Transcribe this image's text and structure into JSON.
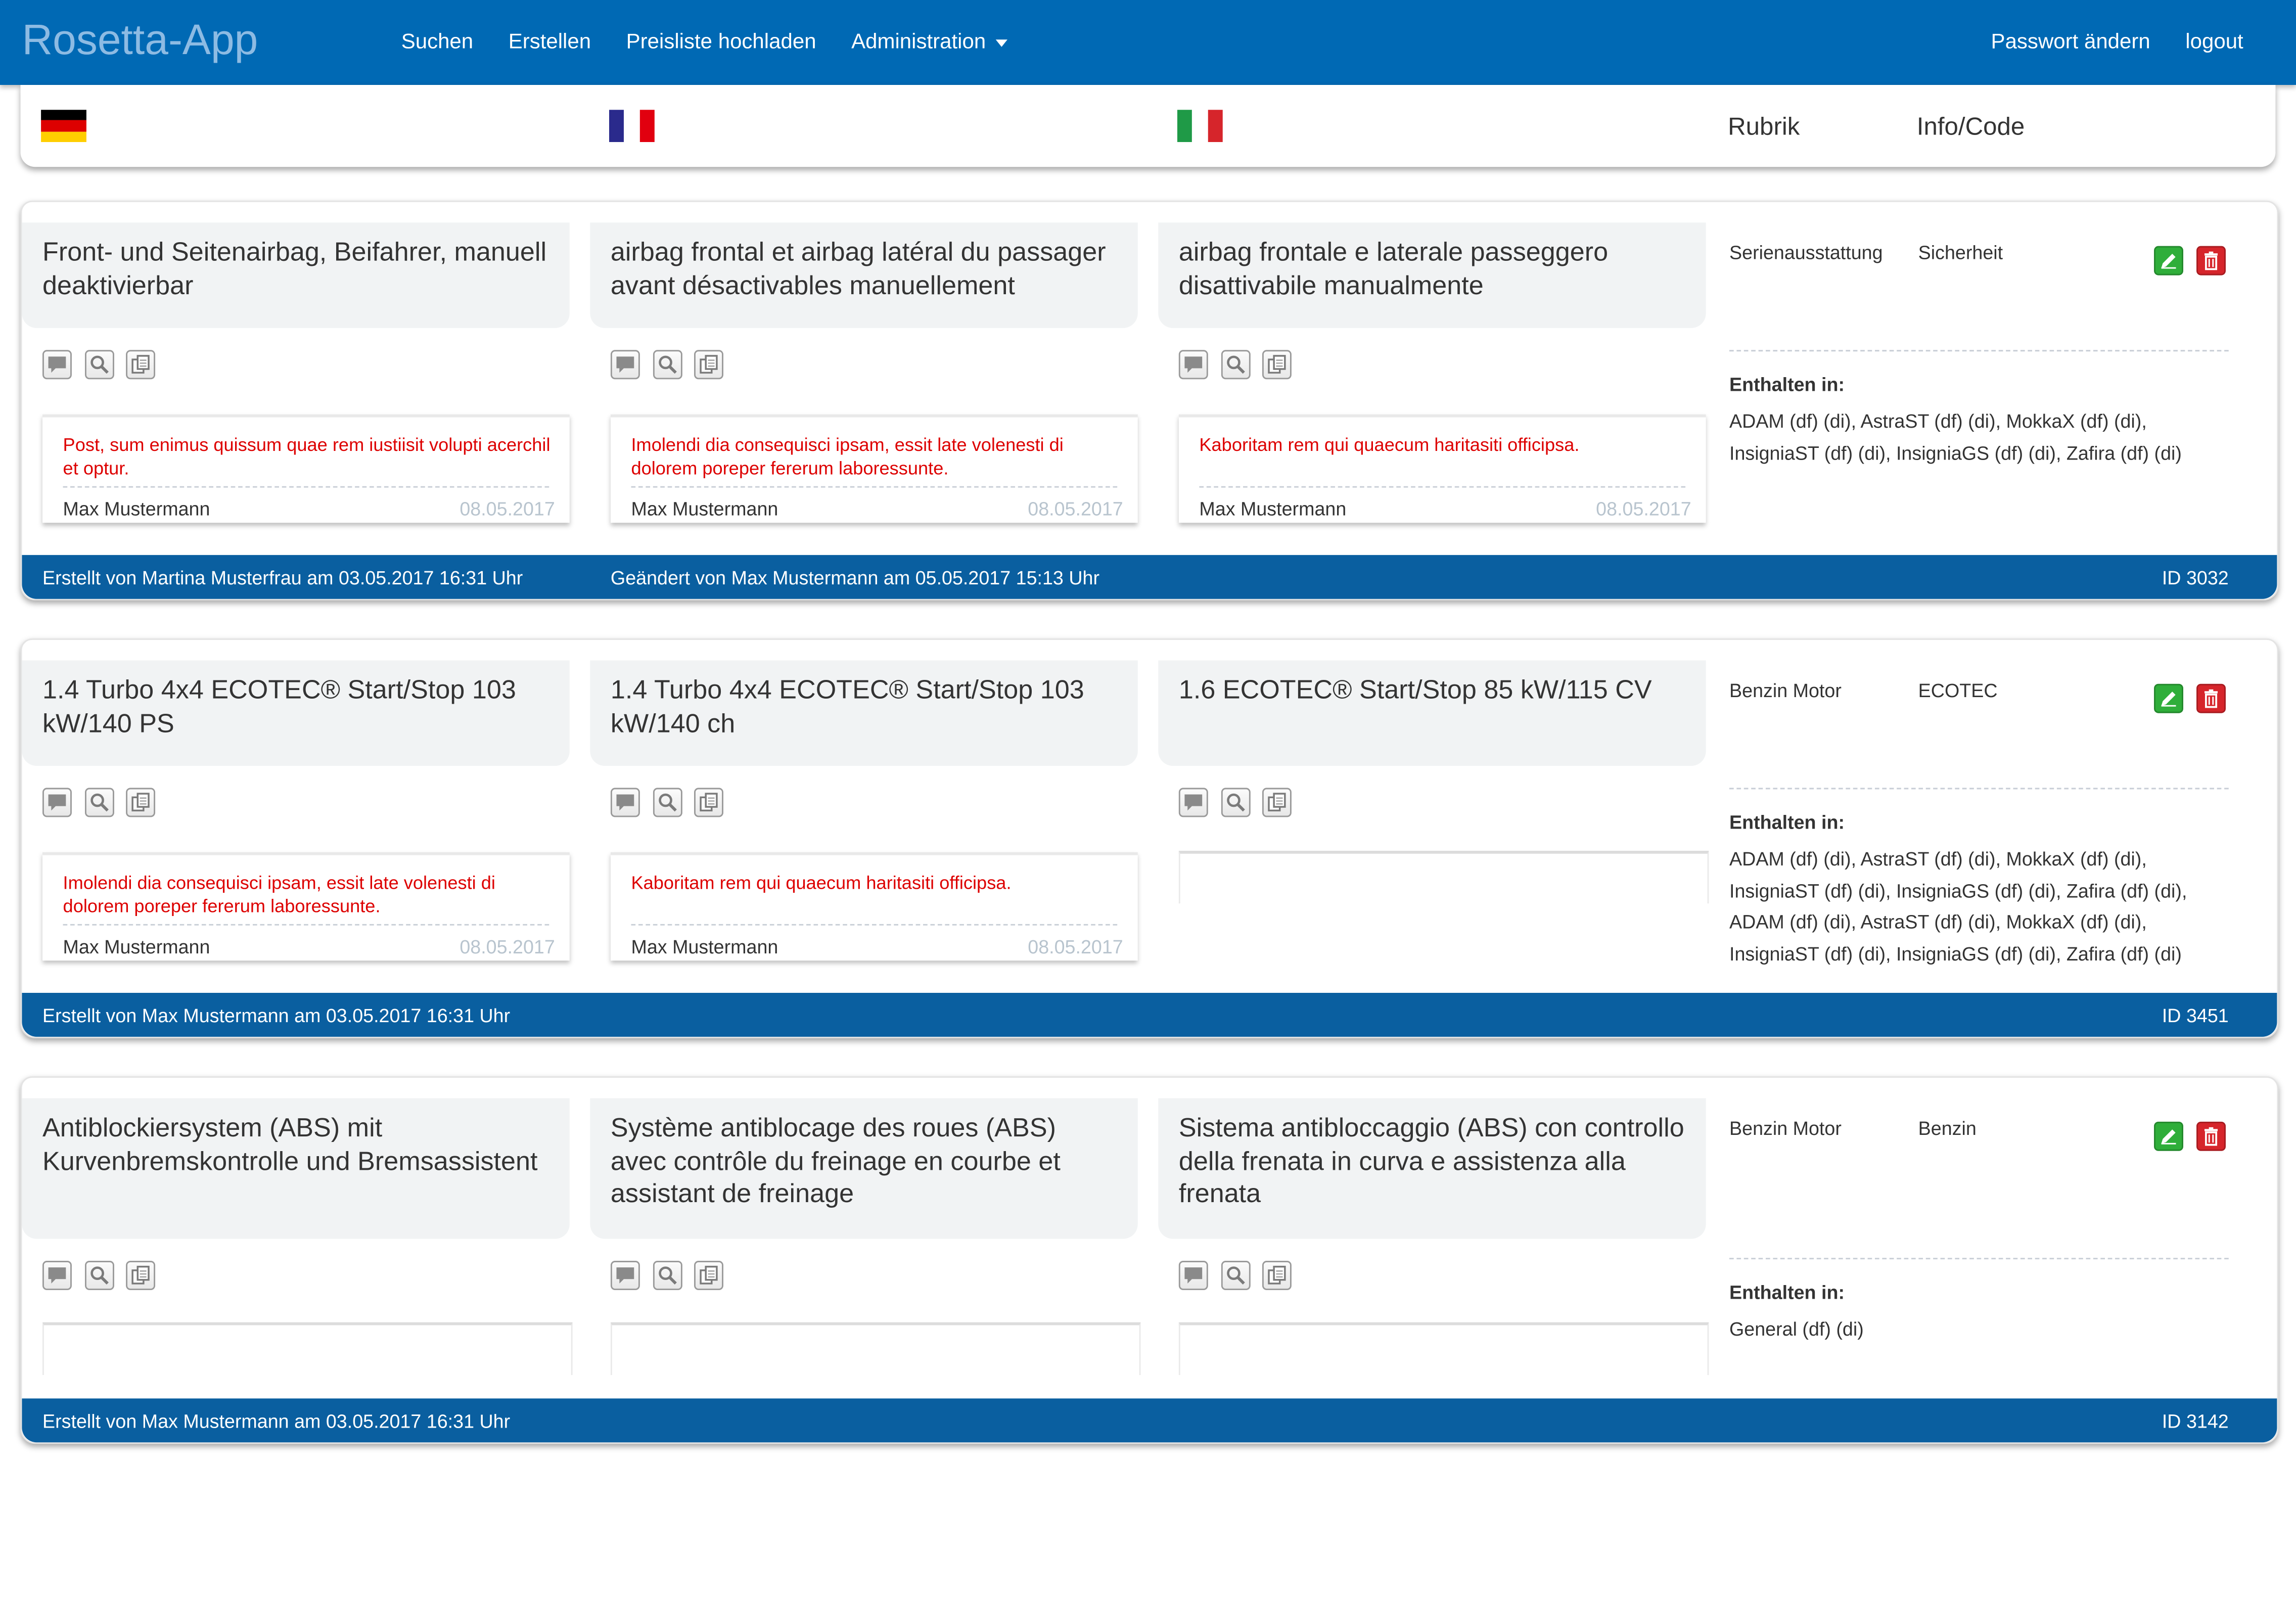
{
  "app": {
    "title": "Rosetta-App"
  },
  "nav": {
    "search": "Suchen",
    "create": "Erstellen",
    "upload": "Preisliste hochladen",
    "admin": "Administration",
    "password": "Passwort ändern",
    "logout": "logout"
  },
  "header": {
    "rubrik": "Rubrik",
    "info_code": "Info/Code",
    "flag_colors": {
      "de": [
        "#000000",
        "#dd0000",
        "#ffce00"
      ],
      "fr": [
        "#2a2a8c",
        "#ffffff",
        "#e1000f"
      ],
      "it": [
        "#1f9a47",
        "#ffffff",
        "#d6252b"
      ]
    }
  },
  "records": [
    {
      "de": "Front- und Seitenairbag, Beifahrer, manuell deaktivierbar",
      "fr": "airbag frontal et airbag latéral du passager avant désactivables manuellement",
      "it": "airbag frontale e laterale passeggero disattivabile manualmente",
      "comments": {
        "de": {
          "text": "Post, sum enimus quissum quae rem iustiisit volupti acerchil et optur.",
          "user": "Max Mustermann",
          "date": "08.05.2017"
        },
        "fr": {
          "text": "Imolendi dia consequisci ipsam, essit late volenesti di dolorem poreper fererum laboressunte.",
          "user": "Max Mustermann",
          "date": "08.05.2017"
        },
        "it": {
          "text": "Kaboritam rem qui quaecum haritasiti officipsa.",
          "user": "Max Mustermann",
          "date": "08.05.2017"
        }
      },
      "rubrik": "Serienausstattung",
      "info": "Sicherheit",
      "enthalten_label": "Enthalten in:",
      "enthalten": "ADAM (df) (di), AstraST (df) (di), MokkaX (df) (di), InsigniaST (df) (di), InsigniaGS (df) (di), Zafira (df) (di)",
      "created": "Erstellt von Martina Musterfrau am 03.05.2017 16:31 Uhr",
      "changed": "Geändert von Max Mustermann am 05.05.2017 15:13 Uhr",
      "id": "ID 3032"
    },
    {
      "de": "1.4 Turbo 4x4 ECOTEC® Start/Stop 103 kW/140 PS",
      "fr": "1.4 Turbo 4x4 ECOTEC® Start/Stop 103 kW/140 ch",
      "it": "1.6 ECOTEC® Start/Stop 85 kW/115 CV",
      "comments": {
        "de": {
          "text": "Imolendi dia consequisci ipsam, essit late volenesti di dolorem poreper fererum laboressunte.",
          "user": "Max Mustermann",
          "date": "08.05.2017"
        },
        "fr": {
          "text": "Kaboritam rem qui quaecum haritasiti officipsa.",
          "user": "Max Mustermann",
          "date": "08.05.2017"
        }
      },
      "rubrik": "Benzin Motor",
      "info": "ECOTEC",
      "enthalten_label": "Enthalten in:",
      "enthalten": "ADAM (df) (di), AstraST (df) (di), MokkaX (df) (di), InsigniaST (df) (di), InsigniaGS (df) (di), Zafira (df) (di), ADAM (df) (di), AstraST (df) (di), MokkaX (df) (di), InsigniaST (df) (di), InsigniaGS (df) (di), Zafira (df) (di)",
      "created": "Erstellt von Max Mustermann am 03.05.2017 16:31 Uhr",
      "id": "ID 3451"
    },
    {
      "de": "Antiblockiersystem (ABS) mit Kurvenbremskontrolle und Bremsassistent",
      "fr": "Système antiblocage des roues (ABS) avec contrôle du freinage en courbe et assistant de freinage",
      "it": "Sistema antibloccaggio (ABS) con controllo della frenata in curva e assistenza alla frenata",
      "rubrik": "Benzin Motor",
      "info": "Benzin",
      "enthalten_label": "Enthalten in:",
      "enthalten": "General (df) (di)",
      "created": "Erstellt von Max Mustermann am 03.05.2017 16:31 Uhr",
      "id": "ID 3142"
    }
  ]
}
